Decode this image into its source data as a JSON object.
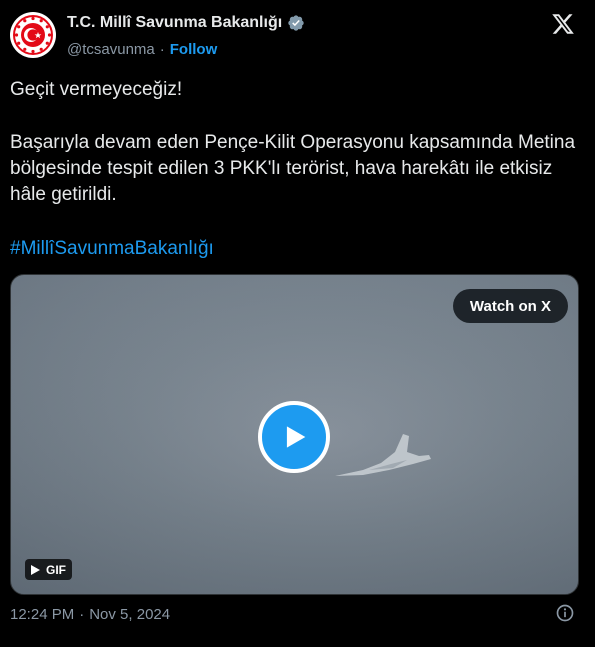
{
  "author": {
    "name": "T.C. Millî Savunma Bakanlığı",
    "handle": "@tcsavunma",
    "separator": "·",
    "follow_label": "Follow",
    "avatar_icon": "turkish-ministry-seal",
    "verified_icon": "verified-badge-gray"
  },
  "platform_icon": "x-logo",
  "tweet": {
    "line1": "Geçit vermeyeceğiz!",
    "paragraph": "Başarıyla devam eden Pençe-Kilit Operasyonu kapsamında Metina bölgesinde tespit edilen 3 PKK'lı terörist, hava harekâtı ile etkisiz hâle getirildi.",
    "hashtag": "#MillîSavunmaBakanlığı"
  },
  "media": {
    "watch_label": "Watch on X",
    "badge_label": "GIF",
    "play_icon": "play-icon"
  },
  "footer": {
    "time": "12:24 PM",
    "separator": "·",
    "date": "Nov 5, 2024",
    "info_icon": "info-icon"
  },
  "colors": {
    "background": "#000000",
    "accent": "#1d9bf0",
    "text": "#e7e9ea",
    "muted": "#8b98a5",
    "seal_red": "#e30a17"
  }
}
